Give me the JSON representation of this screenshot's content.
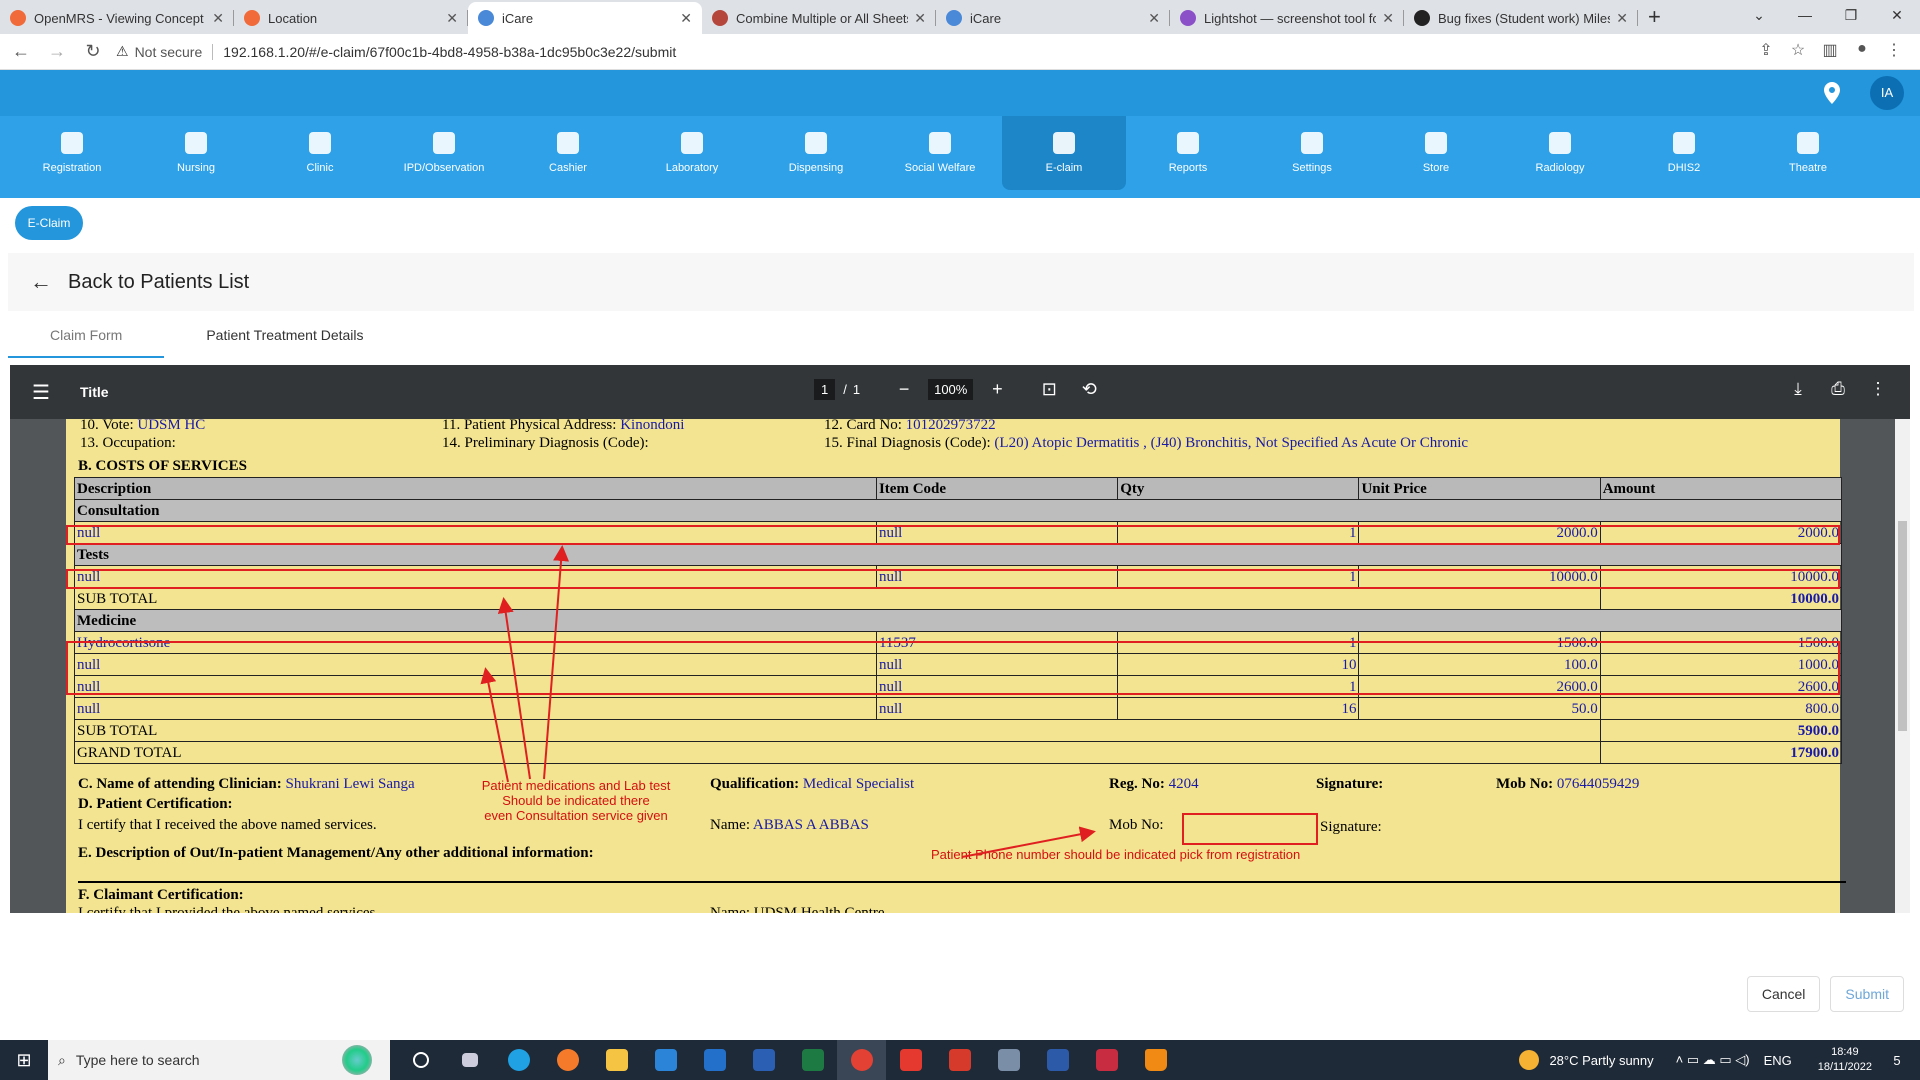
{
  "browser": {
    "tabs": [
      {
        "title": "OpenMRS - Viewing Concept H",
        "icon_color": "#f06a3a"
      },
      {
        "title": "Location",
        "icon_color": "#f06a3a"
      },
      {
        "title": "iCare",
        "icon_color": "#4a88d8"
      },
      {
        "title": "Combine Multiple or All Sheets",
        "icon_color": "#b5463c"
      },
      {
        "title": "iCare",
        "icon_color": "#4a88d8"
      },
      {
        "title": "Lightshot — screenshot tool for",
        "icon_color": "#8b4fc8"
      },
      {
        "title": "Bug fixes (Student work) Milesto",
        "icon_color": "#222222"
      }
    ],
    "not_secure": "Not secure",
    "url": "192.168.1.20/#/e-claim/67f00c1b-4bd8-4958-b38a-1dc95b0c3e22/submit"
  },
  "header": {
    "user_initials": "IA",
    "modules": [
      "Registration",
      "Nursing",
      "Clinic",
      "IPD/Observation",
      "Cashier",
      "Laboratory",
      "Dispensing",
      "Social Welfare",
      "E-claim",
      "Reports",
      "Settings",
      "Store",
      "Radiology",
      "DHIS2",
      "Theatre"
    ],
    "active_module": "E-claim"
  },
  "eclaim_chip": "E-Claim",
  "back_label": "Back to Patients List",
  "tabs": [
    "Claim Form",
    "Patient Treatment Details"
  ],
  "pdf": {
    "title": "Title",
    "page": "1",
    "page_sep": "/",
    "page_total": "1",
    "zoom": "100%"
  },
  "form": {
    "row1": {
      "vote_label": "10. Vote:",
      "vote": "UDSM HC",
      "address_label": "11. Patient Physical Address:",
      "address": "Kinondoni",
      "card_label": "12. Card No:",
      "card": "101202973722"
    },
    "row2": {
      "occupation_label": "13. Occupation:",
      "prelim_label": "14. Preliminary Diagnosis (Code):",
      "final_label": "15. Final Diagnosis (Code):",
      "final": "(L20) Atopic Dermatitis , (J40) Bronchitis, Not Specified As Acute Or Chronic"
    },
    "section_b": "B. COSTS OF SERVICES",
    "table": {
      "headers": [
        "Description",
        "Item Code",
        "Qty",
        "Unit Price",
        "Amount"
      ],
      "consultation_label": "Consultation",
      "consultation": [
        [
          "null",
          "null",
          "1",
          "2000.0",
          "2000.0"
        ]
      ],
      "tests_label": "Tests",
      "tests": [
        [
          "null",
          "null",
          "1",
          "10000.0",
          "10000.0"
        ]
      ],
      "subtotal_label": "SUB TOTAL",
      "subtotal_1": "10000.0",
      "medicine_label": "Medicine",
      "medicine": [
        [
          "Hydrocortisone",
          "11537",
          "1",
          "1500.0",
          "1500.0"
        ],
        [
          "null",
          "null",
          "10",
          "100.0",
          "1000.0"
        ],
        [
          "null",
          "null",
          "1",
          "2600.0",
          "2600.0"
        ],
        [
          "null",
          "null",
          "16",
          "50.0",
          "800.0"
        ]
      ],
      "subtotal_2": "5900.0",
      "grand_total_label": "GRAND TOTAL",
      "grand_total": "17900.0"
    },
    "section_c": {
      "clinician_label": "C. Name of attending Clinician:",
      "clinician": "Shukrani Lewi Sanga",
      "qualification_label": "Qualification:",
      "qualification": "Medical Specialist",
      "reg_label": "Reg. No:",
      "reg": "4204",
      "signature_label": "Signature:",
      "mob_label": "Mob No:",
      "mob": "07644059429"
    },
    "section_d": {
      "label": "D. Patient Certification:",
      "certify": "I certify that I received the above named services.",
      "name_label": "Name:",
      "name": "ABBAS A ABBAS",
      "mob_label": "Mob No:",
      "signature_label": "Signature:"
    },
    "section_e": "E. Description of Out/In-patient Management/Any other additional information:",
    "section_f": "F. Claimant Certification:",
    "section_f_cut": "I certify that I provided the above named services",
    "section_f_name_cut": "Name: UDSM Health Centre"
  },
  "annotations": {
    "note1": [
      "Patient medications and Lab test",
      "Should be indicated there",
      "even Consultation service given"
    ],
    "note2": "Patient Phone number should be indicated pick from registration",
    "color": "#e02020"
  },
  "actions": {
    "cancel": "Cancel",
    "submit": "Submit"
  },
  "taskbar": {
    "search_placeholder": "Type here to search",
    "weather": "28°C  Partly sunny",
    "lang": "ENG",
    "time": "18:49",
    "date": "18/11/2022",
    "notif_count": "5"
  }
}
